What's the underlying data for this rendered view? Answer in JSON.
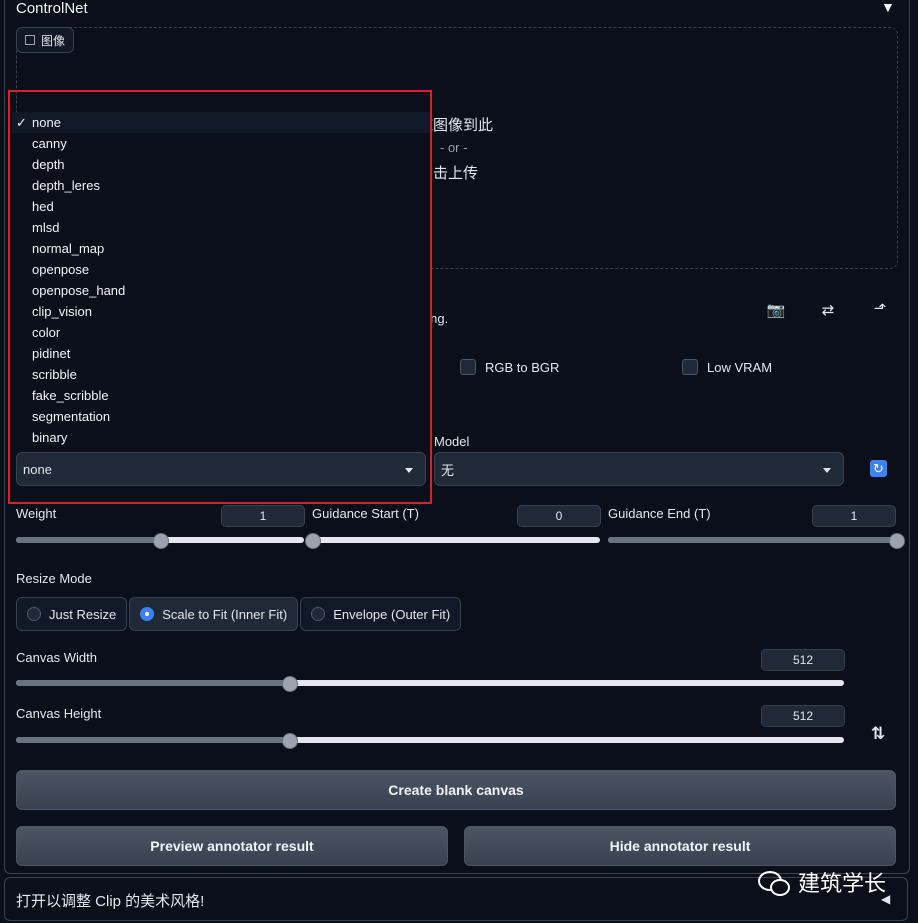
{
  "panel": {
    "title": "ControlNet",
    "collapse_glyph": "▼"
  },
  "image_input": {
    "tag_label": "图像",
    "drop_text": "拖图像到此",
    "or_text": "- or -",
    "click_text": "点击上传"
  },
  "tools": {
    "camera": "📷",
    "swap": "⇄",
    "rotate": "⬏"
  },
  "hint_fragment": "ning.",
  "checkboxes": {
    "rgb_to_bgr": "RGB to BGR",
    "low_vram": "Low VRAM"
  },
  "preprocessor": {
    "selected": "none",
    "options": [
      "none",
      "canny",
      "depth",
      "depth_leres",
      "hed",
      "mlsd",
      "normal_map",
      "openpose",
      "openpose_hand",
      "clip_vision",
      "color",
      "pidinet",
      "scribble",
      "fake_scribble",
      "segmentation",
      "binary"
    ]
  },
  "model": {
    "label": "Model",
    "selected": "无",
    "refresh_icon": "↻"
  },
  "sliders": {
    "weight": {
      "label": "Weight",
      "value": "1",
      "fraction": 0.5
    },
    "guidance_start": {
      "label": "Guidance Start (T)",
      "value": "0",
      "fraction": 0.0
    },
    "guidance_end": {
      "label": "Guidance End (T)",
      "value": "1",
      "fraction": 1.0
    }
  },
  "resize_mode": {
    "label": "Resize Mode",
    "options": [
      "Just Resize",
      "Scale to Fit (Inner Fit)",
      "Envelope (Outer Fit)"
    ],
    "selected": "Scale to Fit (Inner Fit)"
  },
  "canvas": {
    "width": {
      "label": "Canvas Width",
      "value": "512",
      "fraction": 0.33
    },
    "height": {
      "label": "Canvas Height",
      "value": "512",
      "fraction": 0.33
    },
    "swap_icon": "⇅"
  },
  "buttons": {
    "create_blank": "Create blank canvas",
    "preview": "Preview annotator result",
    "hide": "Hide annotator result"
  },
  "bottom": {
    "text": "打开以调整 Clip 的美术风格!",
    "arrow": "◀"
  },
  "watermark": {
    "text": "建筑学长"
  },
  "colors": {
    "accent": "#3b82f6",
    "highlight_border": "#e11d2a",
    "background": "#0b0f19"
  }
}
